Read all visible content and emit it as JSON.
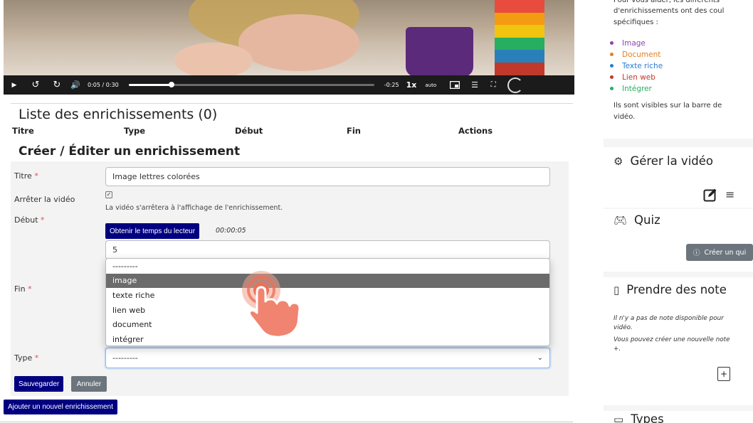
{
  "video": {
    "time_current": "0:05",
    "time_sep": "/",
    "time_total": "0:30",
    "time_remaining": "-0:25",
    "speed": "1x",
    "quality": "auto",
    "progress": 0.175
  },
  "list": {
    "title": "Liste des enrichissements (0)",
    "columns": [
      "Titre",
      "Type",
      "Début",
      "Fin",
      "Actions"
    ]
  },
  "editor": {
    "title": "Créer / Éditer un enrichissement",
    "title_label": "Titre",
    "title_value": "Image lettres colorées",
    "stop_label": "Arrêter la vidéo",
    "stop_checked": true,
    "stop_help": "La vidéo s'arrêtera à l'affichage de l'enrichissement.",
    "start_label": "Début",
    "get_time_button": "Obtenir le temps du lecteur",
    "player_time": "00:00:05",
    "start_value": "5",
    "end_label": "Fin",
    "type_label": "Type",
    "type_value": "---------",
    "type_options": [
      "---------",
      "image",
      "texte riche",
      "lien web",
      "document",
      "intégrer"
    ],
    "highlighted_option": "image",
    "required_mark": "*",
    "save_button": "Sauvegarder",
    "cancel_button": "Annuler",
    "add_button": "Ajouter un nouvel enrichissement"
  },
  "sidebar": {
    "intro_line1": "Pour vous aider, les différents",
    "intro_line2": "d'enrichissements ont des coul",
    "intro_line3": "spécifiques :",
    "legend": [
      {
        "label": "Image",
        "color": "#8e44ad"
      },
      {
        "label": "Document",
        "color": "#e67e22"
      },
      {
        "label": "Texte riche",
        "color": "#2b7bd6"
      },
      {
        "label": "Lien web",
        "color": "#c0392b"
      },
      {
        "label": "Intégrer",
        "color": "#27ae60"
      }
    ],
    "visible_line1": "Ils sont visibles sur la barre de",
    "visible_line2": "vidéo.",
    "manage_title": "Gérer la vidéo",
    "quiz_title": "Quiz",
    "quiz_button": "Créer un qui",
    "notes_title": "Prendre des note",
    "notes_line1": "Il n'y a pas de note disponible pour",
    "notes_line2": "vidéo.",
    "notes_line3": "Vous pouvez créer une nouvelle note",
    "notes_line4": "+.",
    "types_title": "Types"
  }
}
